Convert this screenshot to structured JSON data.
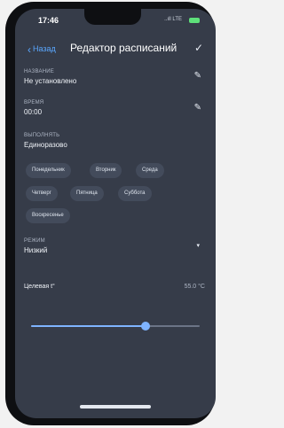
{
  "status_bar": {
    "time": "17:46",
    "signal": "..ıll LTE",
    "battery_color": "#5ee07a"
  },
  "header": {
    "back_label": "Назад",
    "back_icon": "chevron-left-icon",
    "title": "Редактор расписаний",
    "confirm_icon": "check-icon"
  },
  "fields": {
    "name": {
      "label": "НАЗВАНИЕ",
      "value": "Не установлено",
      "edit_icon": "pencil-icon"
    },
    "time": {
      "label": "ВРЕМЯ",
      "value": "00:00",
      "edit_icon": "pencil-icon"
    },
    "repeat": {
      "label": "ВЫПОЛНЯТЬ",
      "value": "Единоразово"
    }
  },
  "days": [
    "Понедельник",
    "Вторник",
    "Среда",
    "Четверг",
    "Пятница",
    "Суббота",
    "Воскресенье"
  ],
  "mode": {
    "label": "РЕЖИМ",
    "value": "Низкий",
    "dropdown_icon": "caret-down-icon"
  },
  "target_temp": {
    "label": "Целевая t°",
    "value": "55.0 °C",
    "slider_fraction": 0.68
  },
  "colors": {
    "background": "#363c49",
    "accent": "#7fb4ff",
    "chip": "#434b5b",
    "link": "#5aa7ff"
  }
}
